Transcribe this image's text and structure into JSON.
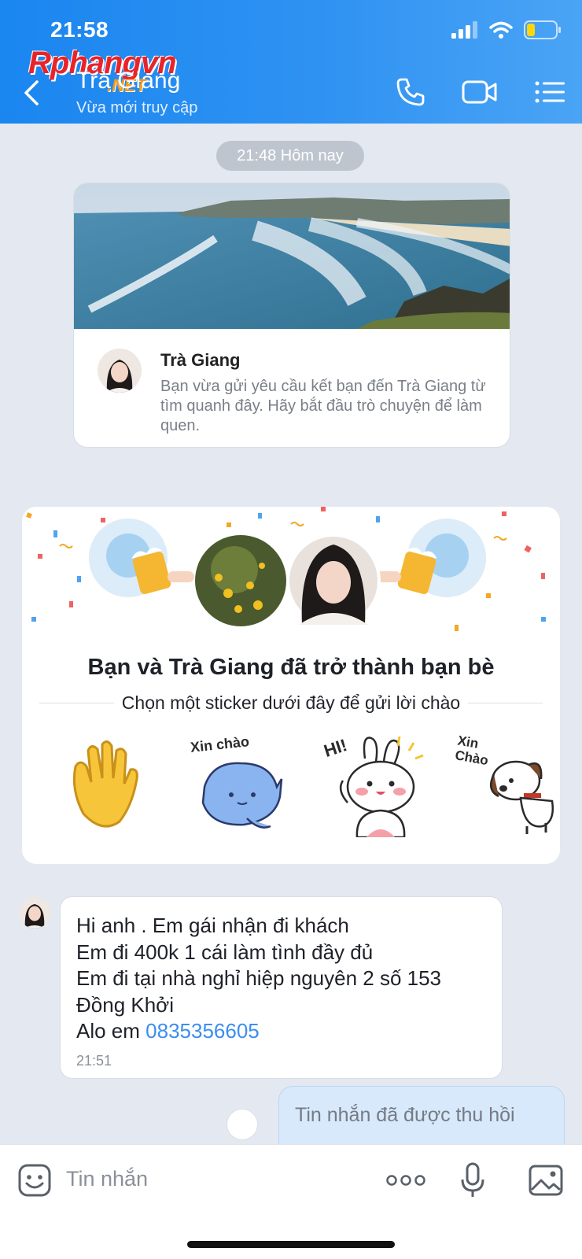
{
  "status_bar": {
    "time": "21:58"
  },
  "watermark": {
    "brand": "Rphangvn",
    "suffix": ".NET"
  },
  "header": {
    "contact_name": "Trà Giang",
    "contact_status": "Vừa mới truy cập",
    "icons": [
      "back-icon",
      "phone-icon",
      "video-call-icon",
      "menu-icon"
    ]
  },
  "chat": {
    "time_chip": "21:48 Hôm nay",
    "friend_request_card": {
      "name": "Trà Giang",
      "text": "Bạn vừa gửi yêu cầu kết bạn đến Trà Giang từ tìm quanh đây. Hãy bắt đầu trò chuyện để làm quen."
    },
    "friendship_card": {
      "title": "Bạn và Trà Giang đã trở thành bạn bè",
      "subtitle": "Chọn một sticker dưới đây để gửi lời chào",
      "stickers": [
        {
          "name": "waving-hand-sticker",
          "caption": ""
        },
        {
          "name": "blue-cat-sticker",
          "caption": "Xin chào"
        },
        {
          "name": "bunny-hi-sticker",
          "caption": "HI!"
        },
        {
          "name": "dog-xin-chao-sticker",
          "caption": "Xin Chào"
        }
      ]
    },
    "incoming_message": {
      "lines": [
        "Hi anh . Em gái nhận đi khách",
        "Em đi 400k 1 cái làm tình đầy đủ",
        "Em đi tại nhà nghỉ hiệp nguyên 2 số 153",
        "Đồng Khởi"
      ],
      "last_line_prefix": "Alo em ",
      "phone": "0835356605",
      "time": "21:51"
    },
    "recalled_message": {
      "text": "Tin nhắn đã được thu hồi"
    }
  },
  "input_bar": {
    "placeholder": "Tin nhắn",
    "icons": [
      "emoji-icon",
      "more-icon",
      "microphone-icon",
      "image-icon"
    ]
  },
  "colors": {
    "header_blue": "#1a86f0",
    "chat_background": "#e4e8f0",
    "link_blue": "#3a8ef0",
    "recall_bubble": "#d7e9fb"
  }
}
